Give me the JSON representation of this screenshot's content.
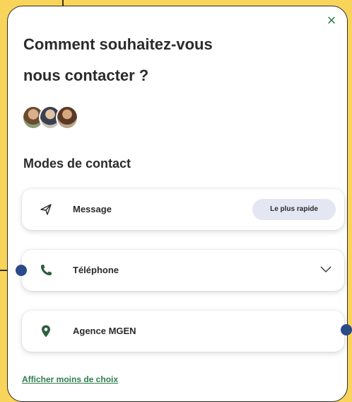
{
  "dialog": {
    "title_line1": "Comment souhaitez-vous",
    "title_line2": "nous contacter ?",
    "close_glyph": "×",
    "section_title": "Modes de contact",
    "options": [
      {
        "label": "Message",
        "icon": "send-icon",
        "badge": "Le plus rapide"
      },
      {
        "label": "Téléphone",
        "icon": "phone-icon",
        "trailing": "chevron-down-icon"
      },
      {
        "label": "Agence MGEN",
        "icon": "location-pin-icon"
      }
    ],
    "footer_link": "Afficher moins de choix"
  },
  "colors": {
    "background": "#f9d45a",
    "accent_green": "#2e7d4f",
    "badge_bg": "#e4e6f3",
    "annotation_dot": "#2a4a8a"
  }
}
